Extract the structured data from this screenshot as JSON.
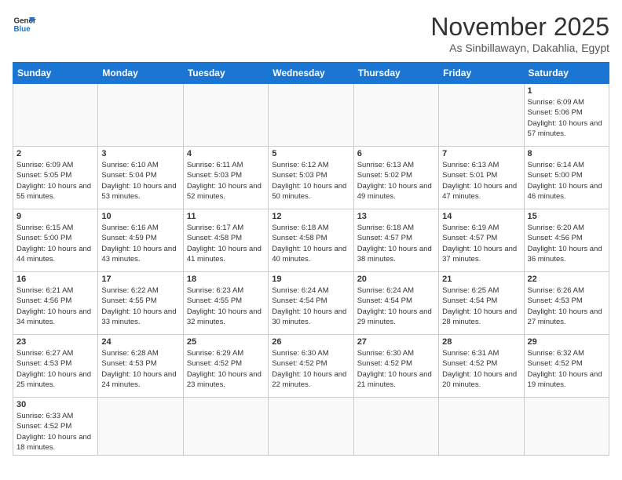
{
  "logo": {
    "line1": "General",
    "line2": "Blue"
  },
  "header": {
    "title": "November 2025",
    "subtitle": "As Sinbillawayn, Dakahlia, Egypt"
  },
  "weekdays": [
    "Sunday",
    "Monday",
    "Tuesday",
    "Wednesday",
    "Thursday",
    "Friday",
    "Saturday"
  ],
  "weeks": [
    [
      {
        "day": "",
        "info": ""
      },
      {
        "day": "",
        "info": ""
      },
      {
        "day": "",
        "info": ""
      },
      {
        "day": "",
        "info": ""
      },
      {
        "day": "",
        "info": ""
      },
      {
        "day": "",
        "info": ""
      },
      {
        "day": "1",
        "info": "Sunrise: 6:09 AM\nSunset: 5:06 PM\nDaylight: 10 hours and 57 minutes."
      }
    ],
    [
      {
        "day": "2",
        "info": "Sunrise: 6:09 AM\nSunset: 5:05 PM\nDaylight: 10 hours and 55 minutes."
      },
      {
        "day": "3",
        "info": "Sunrise: 6:10 AM\nSunset: 5:04 PM\nDaylight: 10 hours and 53 minutes."
      },
      {
        "day": "4",
        "info": "Sunrise: 6:11 AM\nSunset: 5:03 PM\nDaylight: 10 hours and 52 minutes."
      },
      {
        "day": "5",
        "info": "Sunrise: 6:12 AM\nSunset: 5:03 PM\nDaylight: 10 hours and 50 minutes."
      },
      {
        "day": "6",
        "info": "Sunrise: 6:13 AM\nSunset: 5:02 PM\nDaylight: 10 hours and 49 minutes."
      },
      {
        "day": "7",
        "info": "Sunrise: 6:13 AM\nSunset: 5:01 PM\nDaylight: 10 hours and 47 minutes."
      },
      {
        "day": "8",
        "info": "Sunrise: 6:14 AM\nSunset: 5:00 PM\nDaylight: 10 hours and 46 minutes."
      }
    ],
    [
      {
        "day": "9",
        "info": "Sunrise: 6:15 AM\nSunset: 5:00 PM\nDaylight: 10 hours and 44 minutes."
      },
      {
        "day": "10",
        "info": "Sunrise: 6:16 AM\nSunset: 4:59 PM\nDaylight: 10 hours and 43 minutes."
      },
      {
        "day": "11",
        "info": "Sunrise: 6:17 AM\nSunset: 4:58 PM\nDaylight: 10 hours and 41 minutes."
      },
      {
        "day": "12",
        "info": "Sunrise: 6:18 AM\nSunset: 4:58 PM\nDaylight: 10 hours and 40 minutes."
      },
      {
        "day": "13",
        "info": "Sunrise: 6:18 AM\nSunset: 4:57 PM\nDaylight: 10 hours and 38 minutes."
      },
      {
        "day": "14",
        "info": "Sunrise: 6:19 AM\nSunset: 4:57 PM\nDaylight: 10 hours and 37 minutes."
      },
      {
        "day": "15",
        "info": "Sunrise: 6:20 AM\nSunset: 4:56 PM\nDaylight: 10 hours and 36 minutes."
      }
    ],
    [
      {
        "day": "16",
        "info": "Sunrise: 6:21 AM\nSunset: 4:56 PM\nDaylight: 10 hours and 34 minutes."
      },
      {
        "day": "17",
        "info": "Sunrise: 6:22 AM\nSunset: 4:55 PM\nDaylight: 10 hours and 33 minutes."
      },
      {
        "day": "18",
        "info": "Sunrise: 6:23 AM\nSunset: 4:55 PM\nDaylight: 10 hours and 32 minutes."
      },
      {
        "day": "19",
        "info": "Sunrise: 6:24 AM\nSunset: 4:54 PM\nDaylight: 10 hours and 30 minutes."
      },
      {
        "day": "20",
        "info": "Sunrise: 6:24 AM\nSunset: 4:54 PM\nDaylight: 10 hours and 29 minutes."
      },
      {
        "day": "21",
        "info": "Sunrise: 6:25 AM\nSunset: 4:54 PM\nDaylight: 10 hours and 28 minutes."
      },
      {
        "day": "22",
        "info": "Sunrise: 6:26 AM\nSunset: 4:53 PM\nDaylight: 10 hours and 27 minutes."
      }
    ],
    [
      {
        "day": "23",
        "info": "Sunrise: 6:27 AM\nSunset: 4:53 PM\nDaylight: 10 hours and 25 minutes."
      },
      {
        "day": "24",
        "info": "Sunrise: 6:28 AM\nSunset: 4:53 PM\nDaylight: 10 hours and 24 minutes."
      },
      {
        "day": "25",
        "info": "Sunrise: 6:29 AM\nSunset: 4:52 PM\nDaylight: 10 hours and 23 minutes."
      },
      {
        "day": "26",
        "info": "Sunrise: 6:30 AM\nSunset: 4:52 PM\nDaylight: 10 hours and 22 minutes."
      },
      {
        "day": "27",
        "info": "Sunrise: 6:30 AM\nSunset: 4:52 PM\nDaylight: 10 hours and 21 minutes."
      },
      {
        "day": "28",
        "info": "Sunrise: 6:31 AM\nSunset: 4:52 PM\nDaylight: 10 hours and 20 minutes."
      },
      {
        "day": "29",
        "info": "Sunrise: 6:32 AM\nSunset: 4:52 PM\nDaylight: 10 hours and 19 minutes."
      }
    ],
    [
      {
        "day": "30",
        "info": "Sunrise: 6:33 AM\nSunset: 4:52 PM\nDaylight: 10 hours and 18 minutes."
      },
      {
        "day": "",
        "info": ""
      },
      {
        "day": "",
        "info": ""
      },
      {
        "day": "",
        "info": ""
      },
      {
        "day": "",
        "info": ""
      },
      {
        "day": "",
        "info": ""
      },
      {
        "day": "",
        "info": ""
      }
    ]
  ]
}
